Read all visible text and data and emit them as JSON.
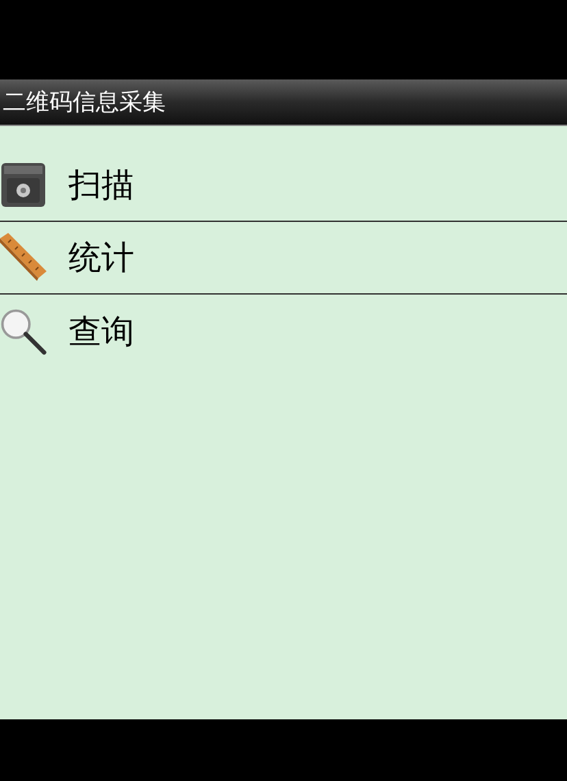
{
  "title_bar": {
    "title": "二维码信息采集"
  },
  "menu": [
    {
      "kind": "safe",
      "label": "扫描"
    },
    {
      "kind": "ruler",
      "label": "统计"
    },
    {
      "kind": "magnifier",
      "label": "查询"
    }
  ]
}
